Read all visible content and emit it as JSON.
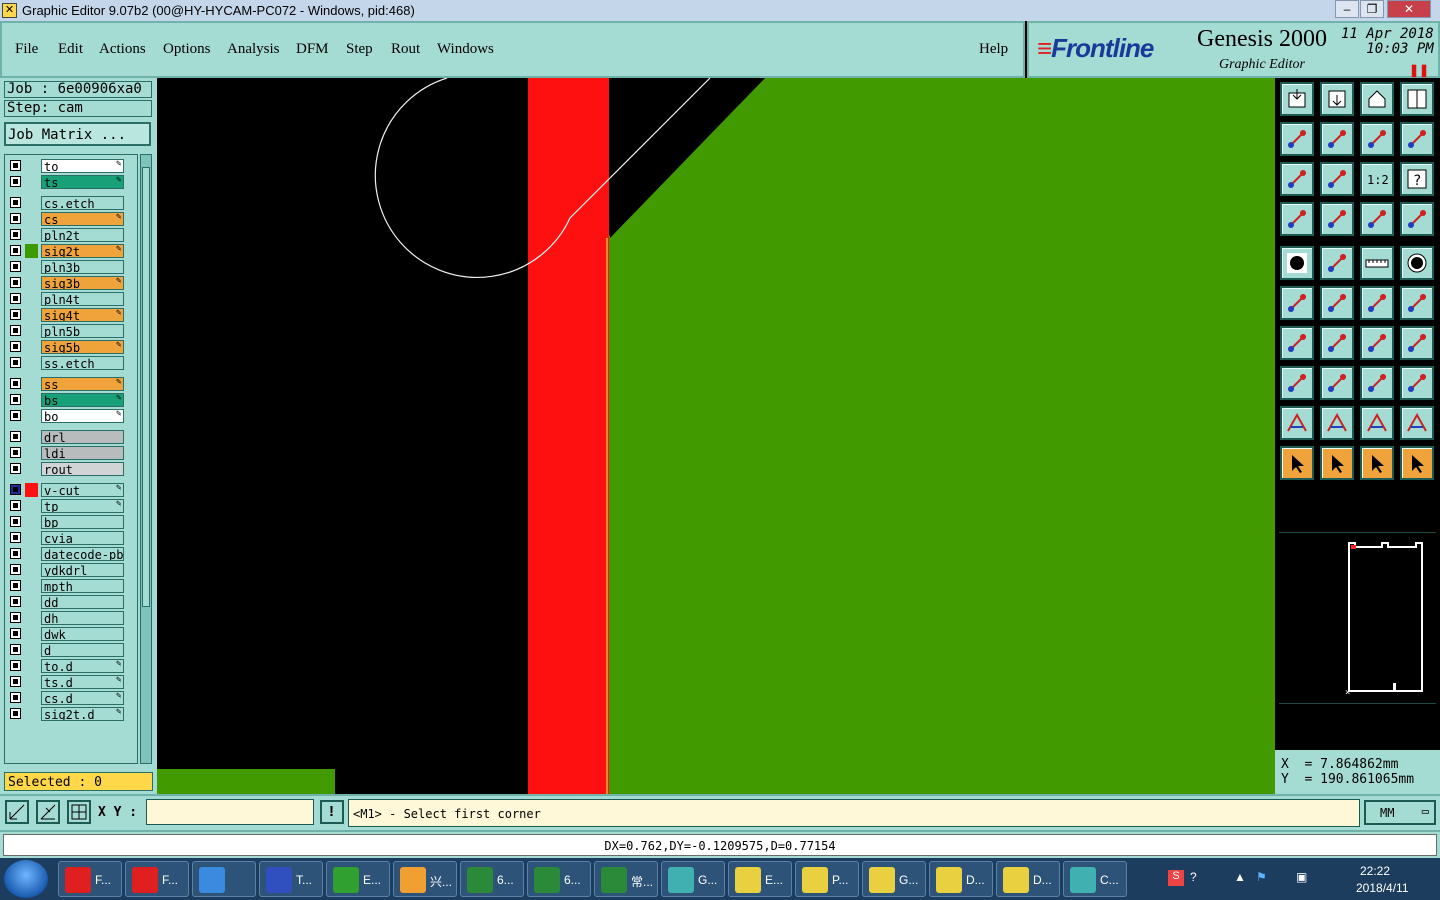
{
  "window": {
    "title": "Graphic Editor 9.07b2 (00@HY-HYCAM-PC072 - Windows, pid:468)",
    "icon": "genesis-app-icon"
  },
  "menu": {
    "items": [
      "File",
      "Edit",
      "Actions",
      "Options",
      "Analysis",
      "DFM",
      "Step",
      "Rout",
      "Windows"
    ],
    "help": "Help"
  },
  "brand": {
    "logo": "Frontline",
    "product": "Genesis 2000",
    "subtitle": "Graphic Editor",
    "date": "11 Apr 2018",
    "time": "10:03 PM"
  },
  "job": {
    "job_line": "Job : 6e00906xa0",
    "step_line": "Step: cam",
    "matrix_button": "Job Matrix ..."
  },
  "layers": [
    {
      "name": "to",
      "bg": "#ffffff",
      "editable": true
    },
    {
      "name": "ts",
      "bg": "#18a078",
      "editable": true
    },
    {
      "name": "cs.etch",
      "bg": "#a4dcd4",
      "editable": false
    },
    {
      "name": "cs",
      "bg": "#f0a33a",
      "editable": true
    },
    {
      "name": "pln2t",
      "bg": "#a4dcd4",
      "editable": false
    },
    {
      "name": "sig2t",
      "bg": "#f0a33a",
      "editable": true,
      "swatch": "#3c9a00"
    },
    {
      "name": "pln3b",
      "bg": "#a4dcd4",
      "editable": false
    },
    {
      "name": "sig3b",
      "bg": "#f0a33a",
      "editable": true
    },
    {
      "name": "pln4t",
      "bg": "#a4dcd4",
      "editable": false
    },
    {
      "name": "sig4t",
      "bg": "#f0a33a",
      "editable": true
    },
    {
      "name": "pln5b",
      "bg": "#a4dcd4",
      "editable": false
    },
    {
      "name": "sig5b",
      "bg": "#f0a33a",
      "editable": true
    },
    {
      "name": "ss.etch",
      "bg": "#a4dcd4",
      "editable": false
    },
    {
      "name": "ss",
      "bg": "#f0a33a",
      "editable": true
    },
    {
      "name": "bs",
      "bg": "#18a078",
      "editable": true
    },
    {
      "name": "bo",
      "bg": "#ffffff",
      "editable": true
    },
    {
      "name": "drl",
      "bg": "#b8bcbc",
      "editable": false
    },
    {
      "name": "ldi",
      "bg": "#b8bcbc",
      "editable": false
    },
    {
      "name": "rout",
      "bg": "#d0d4d4",
      "editable": false
    },
    {
      "name": "v-cut",
      "bg": "#a4dcd4",
      "editable": true,
      "swatch": "#ff1010",
      "active": true
    },
    {
      "name": "tp",
      "bg": "#a4dcd4",
      "editable": true
    },
    {
      "name": "bp",
      "bg": "#a4dcd4",
      "editable": false
    },
    {
      "name": "cvia",
      "bg": "#a4dcd4",
      "editable": false
    },
    {
      "name": "datecode-pbc",
      "bg": "#a4dcd4",
      "editable": false
    },
    {
      "name": "ydkdrl",
      "bg": "#a4dcd4",
      "editable": false
    },
    {
      "name": "mpth",
      "bg": "#a4dcd4",
      "editable": false
    },
    {
      "name": "dd",
      "bg": "#a4dcd4",
      "editable": false
    },
    {
      "name": "dh",
      "bg": "#a4dcd4",
      "editable": false
    },
    {
      "name": "dwk",
      "bg": "#a4dcd4",
      "editable": false
    },
    {
      "name": "d",
      "bg": "#a4dcd4",
      "editable": false
    },
    {
      "name": "to.d",
      "bg": "#a4dcd4",
      "editable": true
    },
    {
      "name": "ts.d",
      "bg": "#a4dcd4",
      "editable": true
    },
    {
      "name": "cs.d",
      "bg": "#a4dcd4",
      "editable": true
    },
    {
      "name": "sig2t.d",
      "bg": "#a4dcd4",
      "editable": true
    }
  ],
  "selection": {
    "label": "Selected : 0"
  },
  "coords": {
    "x": "X  = 7.864862mm",
    "y": "Y  = 190.861065mm"
  },
  "command": {
    "xy_label": "X Y :",
    "input_value": "",
    "prompt": "<M1> - Select first corner",
    "units": "MM"
  },
  "status": {
    "measure": "DX=0.762,DY=-0.1209575,D=0.77154"
  },
  "toolbar_icons": [
    "open-step-icon",
    "save-icon",
    "home-icon",
    "window-icon",
    "prev-icon",
    "next-icon",
    "undo-view-icon",
    "redo-view-icon",
    "zoom-fit-icon",
    "zoom-center-icon",
    "scale-1-2-icon",
    "help-icon",
    "snap-settings-icon",
    "probe-icon",
    "layer-features-icon",
    "layer-attrs-icon",
    "fill-pad-icon",
    "outline-shape-icon",
    "ruler-icon",
    "circle-pad-icon",
    "connect-icon",
    "delete-node-icon",
    "add-line-icon",
    "add-point-icon",
    "angle-line-icon",
    "draw-line-icon",
    "arc-icon",
    "split-icon",
    "move-point-icon",
    "horizontal-line-icon",
    "resize-icon",
    "shapes-icon",
    "triangle-icon",
    "peak-icon",
    "arch-icon",
    "arch-line-icon",
    "select-arrow-icon",
    "select-box-icon",
    "select-circle-icon",
    "select-route-icon"
  ],
  "taskbar": {
    "items": [
      {
        "label": "F...",
        "icon": "frontline-icon"
      },
      {
        "label": "F...",
        "icon": "frontline-icon"
      },
      {
        "label": "",
        "icon": "ie-icon"
      },
      {
        "label": "T...",
        "icon": "floppy-icon"
      },
      {
        "label": "E...",
        "icon": "f-green-icon"
      },
      {
        "label": "兴...",
        "icon": "shell-icon"
      },
      {
        "label": "6...",
        "icon": "excel-icon"
      },
      {
        "label": "6...",
        "icon": "excel-icon"
      },
      {
        "label": "常...",
        "icon": "excel-icon"
      },
      {
        "label": "G...",
        "icon": "eye-icon"
      },
      {
        "label": "E...",
        "icon": "genesis-icon"
      },
      {
        "label": "P...",
        "icon": "genesis-icon"
      },
      {
        "label": "G...",
        "icon": "genesis-icon"
      },
      {
        "label": "D...",
        "icon": "genesis-icon"
      },
      {
        "label": "D...",
        "icon": "genesis-icon"
      },
      {
        "label": "C...",
        "icon": "eye-icon"
      }
    ],
    "clock_time": "22:22",
    "clock_date": "2018/4/11"
  }
}
